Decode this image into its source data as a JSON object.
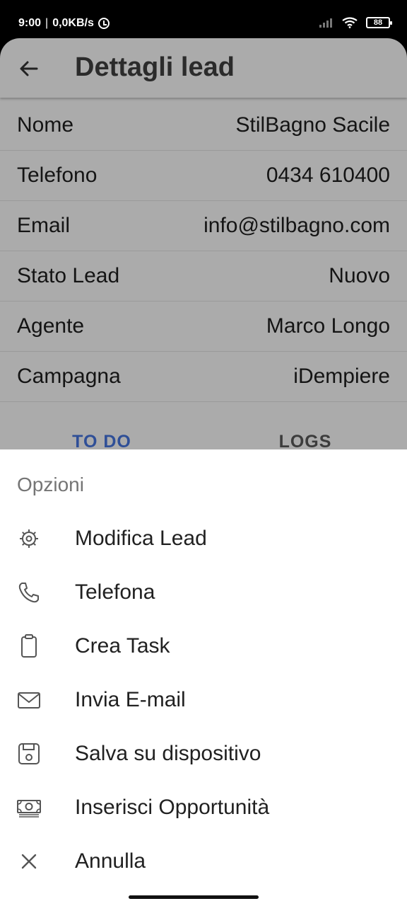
{
  "status_bar": {
    "time": "9:00",
    "network_speed": "0,0KB/s",
    "battery": "88"
  },
  "header": {
    "title": "Dettagli lead"
  },
  "details": [
    {
      "label": "Nome",
      "value": "StilBagno Sacile"
    },
    {
      "label": "Telefono",
      "value": "0434 610400"
    },
    {
      "label": "Email",
      "value": "info@stilbagno.com"
    },
    {
      "label": "Stato Lead",
      "value": "Nuovo"
    },
    {
      "label": "Agente",
      "value": "Marco Longo"
    },
    {
      "label": "Campagna",
      "value": "iDempiere"
    }
  ],
  "tabs": [
    {
      "label": "TO DO",
      "active": true
    },
    {
      "label": "LOGS",
      "active": false
    }
  ],
  "sheet": {
    "title": "Opzioni",
    "options": [
      {
        "label": "Modifica Lead",
        "icon": "gear-icon"
      },
      {
        "label": "Telefona",
        "icon": "phone-icon"
      },
      {
        "label": "Crea Task",
        "icon": "clipboard-icon"
      },
      {
        "label": "Invia E-mail",
        "icon": "envelope-icon"
      },
      {
        "label": "Salva su dispositivo",
        "icon": "save-icon"
      },
      {
        "label": "Inserisci Opportunità",
        "icon": "money-icon"
      },
      {
        "label": "Annulla",
        "icon": "close-icon"
      }
    ]
  }
}
